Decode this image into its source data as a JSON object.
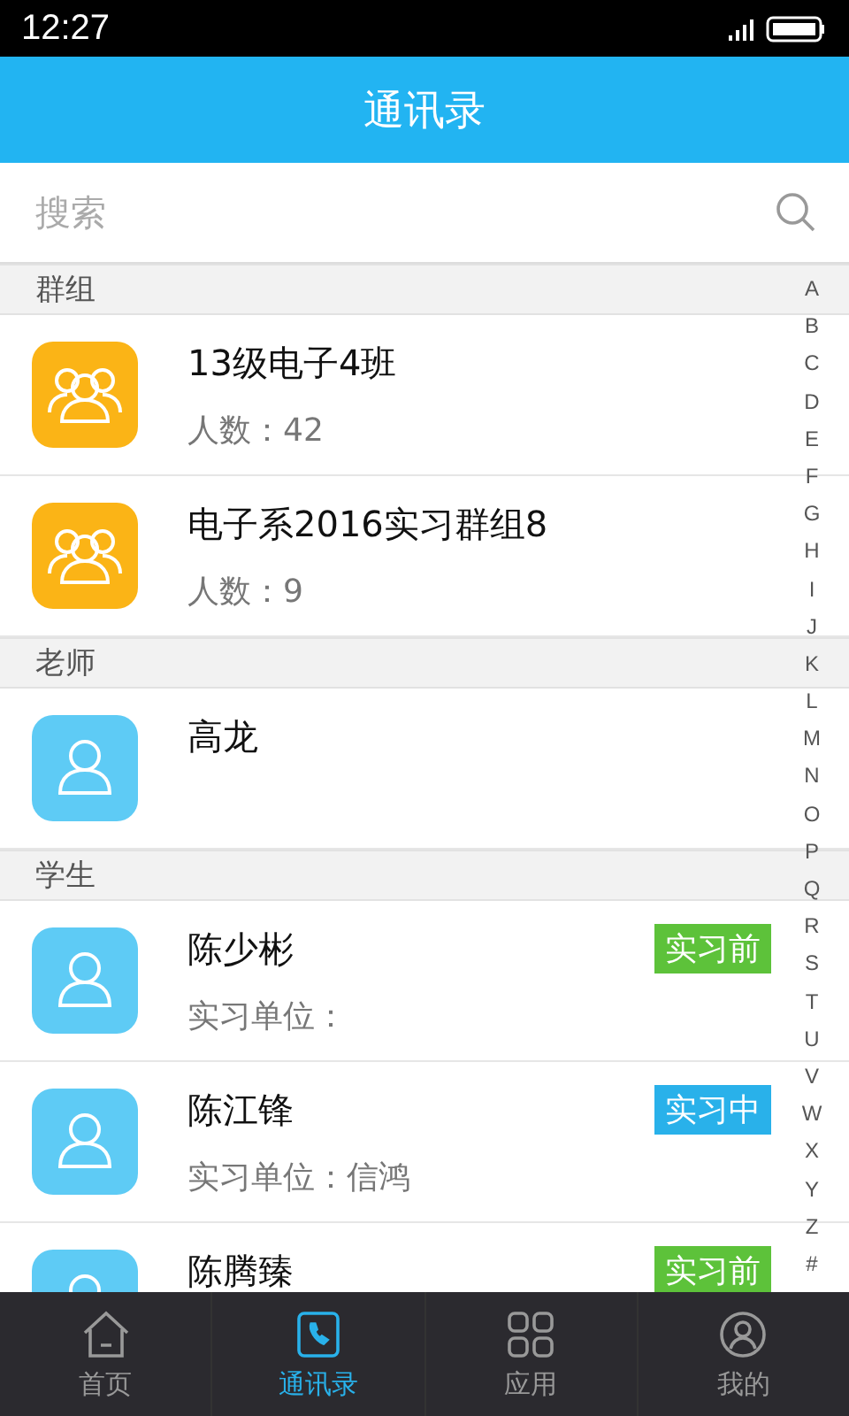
{
  "status_bar": {
    "time": "12:27"
  },
  "header": {
    "title": "通讯录"
  },
  "search": {
    "placeholder": "搜索"
  },
  "sections": [
    {
      "title": "群组",
      "items": [
        {
          "kind": "group",
          "name": "13级电子4班",
          "subtitle": "人数：42"
        },
        {
          "kind": "group",
          "name": "电子系2016实习群组8",
          "subtitle": "人数：9"
        }
      ]
    },
    {
      "title": "老师",
      "items": [
        {
          "kind": "person",
          "name": "高龙"
        }
      ]
    },
    {
      "title": "学生",
      "items": [
        {
          "kind": "person",
          "name": "陈少彬",
          "subtitle": "实习单位：",
          "tag": {
            "text": "实习前",
            "color": "#5dc23a"
          }
        },
        {
          "kind": "person",
          "name": "陈江锋",
          "subtitle": "实习单位：信鸿",
          "tag": {
            "text": "实习中",
            "color": "#29b1ea"
          }
        },
        {
          "kind": "person",
          "name": "陈腾臻",
          "tag": {
            "text": "实习前",
            "color": "#5dc23a"
          }
        }
      ]
    }
  ],
  "index": [
    "A",
    "B",
    "C",
    "D",
    "E",
    "F",
    "G",
    "H",
    "I",
    "J",
    "K",
    "L",
    "M",
    "N",
    "O",
    "P",
    "Q",
    "R",
    "S",
    "T",
    "U",
    "V",
    "W",
    "X",
    "Y",
    "Z",
    "#"
  ],
  "tabs": [
    {
      "kind": "home",
      "label": "首页",
      "selected": false
    },
    {
      "kind": "contacts",
      "label": "通讯录",
      "selected": true
    },
    {
      "kind": "apps",
      "label": "应用",
      "selected": false
    },
    {
      "kind": "me",
      "label": "我的",
      "selected": false
    }
  ]
}
